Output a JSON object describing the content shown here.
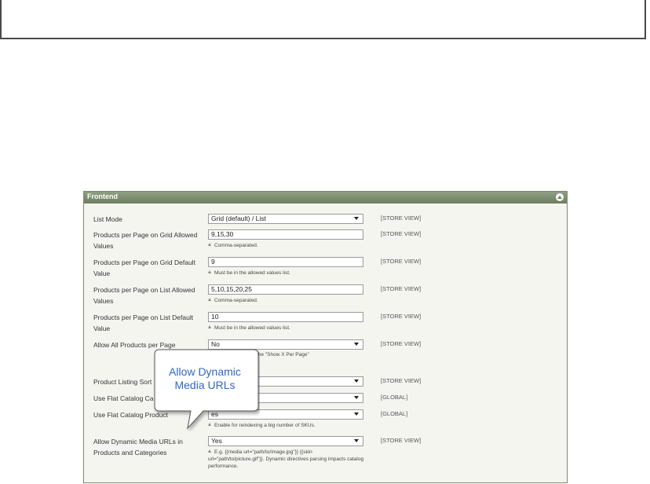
{
  "panel": {
    "title": "Frontend"
  },
  "fields": {
    "list_mode": {
      "label": "List Mode",
      "value": "Grid (default) / List",
      "scope": "[STORE VIEW]"
    },
    "grid_allowed": {
      "label": "Products per Page on Grid Allowed Values",
      "value": "9,15,30",
      "note": "Comma-separated.",
      "scope": "[STORE VIEW]"
    },
    "grid_default": {
      "label": "Products per Page on Grid Default Value",
      "value": "9",
      "note": "Must be in the allowed values list.",
      "scope": "[STORE VIEW]"
    },
    "list_allowed": {
      "label": "Products per Page on List Allowed Values",
      "value": "5,10,15,20,25",
      "note": "Comma-separated.",
      "scope": "[STORE VIEW]"
    },
    "list_default": {
      "label": "Products per Page on List Default Value",
      "value": "10",
      "note": "Must be in the allowed values list.",
      "scope": "[STORE VIEW]"
    },
    "allow_all": {
      "label": "Allow All Products per Page",
      "value": "No",
      "note": "\"All\" option in the \"Show X Per Page\"",
      "scope": "[STORE VIEW]"
    },
    "listing_sort": {
      "label": "Product Listing Sort",
      "scope": "[STORE VIEW]"
    },
    "flat_category": {
      "label": "Use Flat Catalog Ca",
      "scope": "[GLOBAL]"
    },
    "flat_product": {
      "label": "Use Flat Catalog Product",
      "value": "es",
      "note": "Enable for reindexing a big number of SKUs.",
      "scope": "[GLOBAL]"
    },
    "dynamic_media": {
      "label": "Allow Dynamic Media URLs in Products and Categories",
      "value": "Yes",
      "note": "E.g. {{media url=\"path/to/image.jpg\"}} {{skin url=\"path/to/picture.gif\"}}. Dynamic directives parsing impacts catalog performance.",
      "scope": "[STORE VIEW]"
    }
  },
  "callout": {
    "text": "Allow Dynamic Media URLs"
  }
}
